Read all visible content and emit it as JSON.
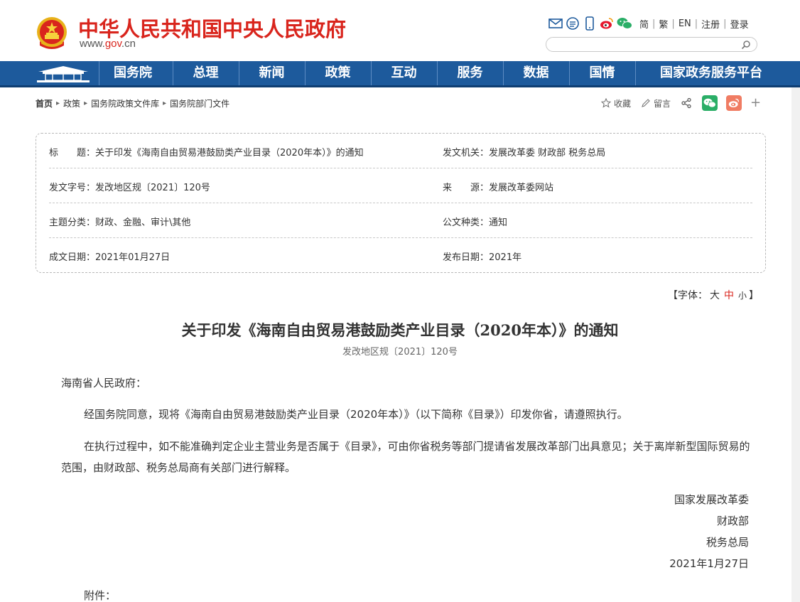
{
  "header": {
    "site_title": "中华人民共和国中央人民政府",
    "site_url_prefix": "www.",
    "site_url_gov": "gov",
    "site_url_suffix": ".cn",
    "brand_red": "#d9251d",
    "tool_icons": [
      "mail-icon",
      "rss-icon",
      "mobile-icon",
      "weibo-icon",
      "wechat-icon"
    ],
    "links": [
      "简",
      "繁",
      "EN",
      "注册",
      "登录"
    ],
    "search_placeholder": ""
  },
  "nav": {
    "color": "#1d5a9c",
    "items": [
      "国务院",
      "总理",
      "新闻",
      "政策",
      "互动",
      "服务",
      "数据",
      "国情",
      "国家政务服务平台"
    ]
  },
  "breadcrumb": [
    "首页",
    "政策",
    "国务院政策文件库",
    "国务院部门文件"
  ],
  "share": {
    "favorite": "收藏",
    "comment": "留言"
  },
  "info": {
    "title_label": "标　　题：",
    "title_value": "关于印发《海南自由贸易港鼓励类产业目录（2020年本）》的通知",
    "issuer_label": "发文机关：",
    "issuer_value": "发展改革委  财政部  税务总局",
    "doc_no_label": "发文字号：",
    "doc_no_value": "发改地区规〔2021〕120号",
    "source_label": "来　　源：",
    "source_value": "发展改革委网站",
    "topic_label": "主题分类：",
    "topic_value": "财政、金融、审计\\其他",
    "type_label": "公文种类：",
    "type_value": "通知",
    "written_label": "成文日期：",
    "written_value": "2021年01月27日",
    "published_label": "发布日期：",
    "published_value": "2021年"
  },
  "font_size": {
    "prefix": "【字体：",
    "large": "大",
    "medium": "中",
    "small": "小",
    "suffix": "】"
  },
  "document": {
    "title": "关于印发《海南自由贸易港鼓励类产业目录（2020年本）》的通知",
    "number": "发改地区规〔2021〕120号",
    "salutation": "海南省人民政府：",
    "para1": "经国务院同意，现将《海南自由贸易港鼓励类产业目录（2020年本）》（以下简称《目录》）印发你省，请遵照执行。",
    "para2": "在执行过程中，如不能准确判定企业主营业务是否属于《目录》，可由你省税务等部门提请省发展改革部门出具意见；关于离岸新型国际贸易的范围，由财政部、税务总局商有关部门进行解释。",
    "signers": [
      "国家发展改革委",
      "财政部",
      "税务总局"
    ],
    "date": "2021年1月27日",
    "attachment_label": "附件："
  }
}
